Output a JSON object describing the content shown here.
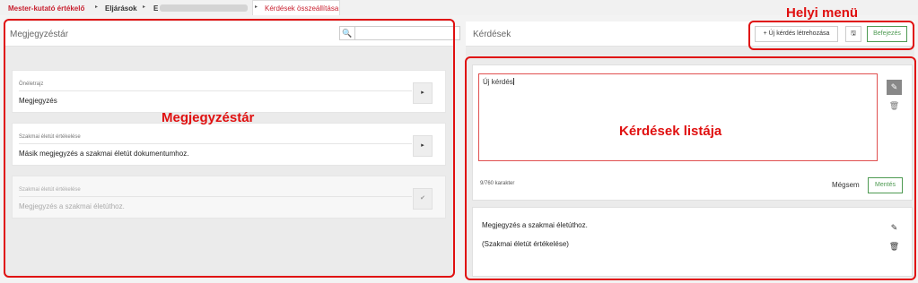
{
  "breadcrumb": {
    "items": [
      "Mester-kutató értékelő",
      "Eljárások",
      "E",
      "Kérdések összeállítása"
    ],
    "separator": "▸"
  },
  "left_panel": {
    "title": "Megjegyzéstár",
    "search": {
      "placeholder": "",
      "icon": "search-icon"
    },
    "cards": [
      {
        "category": "Önéletrajz",
        "text": "Megjegyzés",
        "button_icon": "chevron-right-icon",
        "button_glyph": "▸",
        "disabled": false
      },
      {
        "category": "Szakmai életút értékelése",
        "text": "Másik megjegyzés a szakmai életút dokumentumhoz.",
        "button_icon": "chevron-right-icon",
        "button_glyph": "▸",
        "disabled": false
      },
      {
        "category": "Szakmai életút értékelése",
        "text": "Megjegyzés a szakmai életúthoz.",
        "button_icon": "check-icon",
        "button_glyph": "✔",
        "disabled": true
      }
    ]
  },
  "right_panel": {
    "title": "Kérdések",
    "toolbar": {
      "new_question_label": "+ Új kérdés létrehozása",
      "save_icon_glyph": "🖫",
      "finish_label": "Befejezés"
    },
    "editor": {
      "value": "Új kérdés",
      "char_count": "9/760 karakter",
      "cancel_label": "Mégsem",
      "save_label": "Mentés",
      "edit_glyph": "✎",
      "delete_glyph": "🗑"
    },
    "list_item": {
      "text": "Megjegyzés a szakmai életúthoz.",
      "source": "(Szakmai életút értékelése)",
      "edit_glyph": "✎",
      "delete_glyph": "🗑"
    }
  },
  "annotations": {
    "left": "Megjegyzéstár",
    "right": "Kérdések listája",
    "menu": "Helyi menü"
  },
  "colors": {
    "brand_red": "#c8202f",
    "annotation_red": "#e01010",
    "green": "#4e9a52"
  }
}
